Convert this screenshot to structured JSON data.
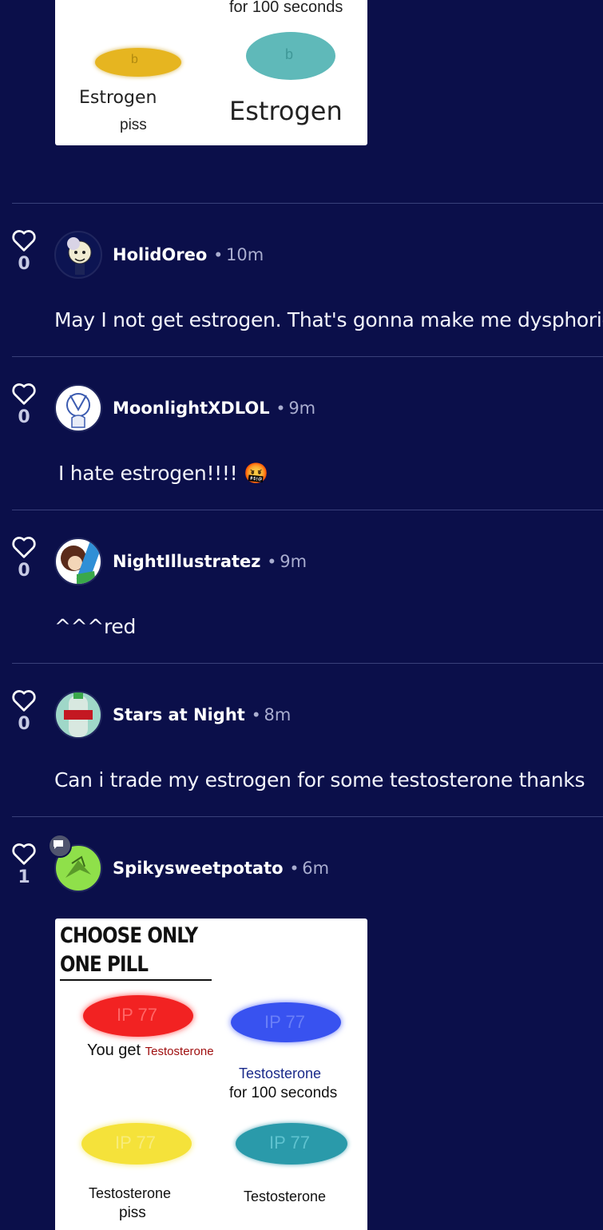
{
  "top_image": {
    "caption_top": "for 100 seconds",
    "pill_left_label": "Estrogen",
    "pill_left_sub": "piss",
    "pill_right_label": "Estrogen"
  },
  "comments": [
    {
      "likes": "0",
      "username": "HolidOreo",
      "time": "10m",
      "text": "May I not get estrogen. That's gonna make me dysphoric"
    },
    {
      "likes": "0",
      "username": "MoonlightXDLOL",
      "time": "9m",
      "text": "I hate estrogen!!!! 🤬"
    },
    {
      "likes": "0",
      "username": "NightIllustratez",
      "time": "9m",
      "text": "^^^red"
    },
    {
      "likes": "0",
      "username": "Stars at Night",
      "time": "8m",
      "text": "Can i trade my estrogen for some testosterone thanks"
    },
    {
      "likes": "1",
      "username": "Spikysweetpotato",
      "time": "6m",
      "text": ""
    }
  ],
  "separator": "•",
  "bottom_image": {
    "title_line1": "CHOOSE ONLY",
    "title_line2": "ONE PILL",
    "red_label": "You get",
    "red_label_word": "Testosterone",
    "blue_label_line1": "Testosterone",
    "blue_label_line2": "for 100 seconds",
    "yellow_label_line1": "Testosterone",
    "yellow_label_line2": "piss",
    "teal_label": "Testosterone",
    "pill_imprint": "IP 77"
  },
  "colors": {
    "background": "#0b0f4a",
    "divider": "#39407a",
    "muted": "#a9adcf"
  },
  "icons": {
    "like": "heart-outline-icon",
    "reply_badge": "chat-bubble-icon"
  }
}
